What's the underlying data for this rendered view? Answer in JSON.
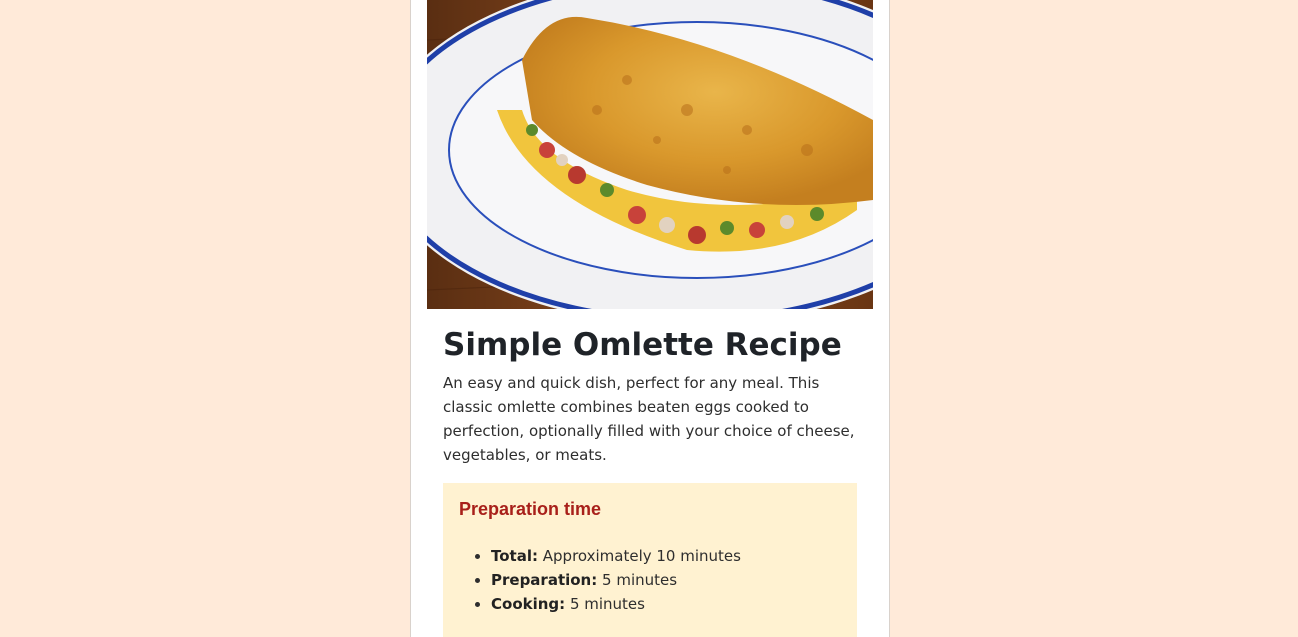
{
  "recipe": {
    "title": "Simple Omlette Recipe",
    "description": "An easy and quick dish, perfect for any meal. This classic omlette combines beaten eggs cooked to perfection, optionally filled with your choice of cheese, vegetables, or meats.",
    "image": "omelette-photo"
  },
  "preparation": {
    "heading": "Preparation time",
    "items": [
      {
        "label": "Total:",
        "value": "Approximately 10 minutes"
      },
      {
        "label": "Preparation:",
        "value": "5 minutes"
      },
      {
        "label": "Cooking:",
        "value": "5 minutes"
      }
    ]
  },
  "colors": {
    "page_background": "#ffead9",
    "card_background": "#ffffff",
    "prep_box_background": "#fff2d1",
    "prep_heading": "#a8201a",
    "plate_rim": "#1f3fa8"
  }
}
